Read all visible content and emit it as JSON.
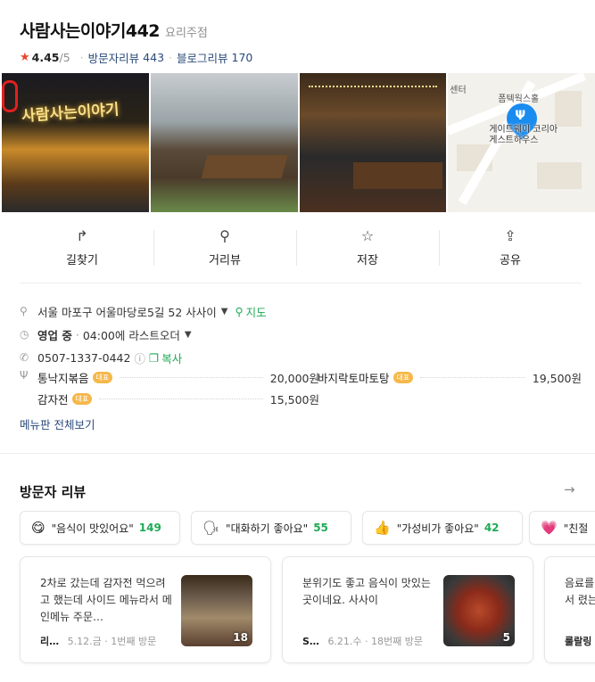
{
  "place": {
    "name": "사람사는이야기442",
    "category": "요리주점",
    "rating": "4.45",
    "rating_max": "/5",
    "visitor_review_label": "방문자리뷰",
    "visitor_review_count": "443",
    "blog_review_label": "블로그리뷰",
    "blog_review_count": "170"
  },
  "photos": {
    "sign_text": "사람사는이야기",
    "map_labels": {
      "center": "센터",
      "hall": "폼텍웍스홀",
      "pin_label_1": "게이트웨이 코리아",
      "pin_label_2": "게스트하우스"
    }
  },
  "actions": [
    {
      "label": "길찾기",
      "icon": "directions-icon"
    },
    {
      "label": "거리뷰",
      "icon": "street-view-icon"
    },
    {
      "label": "저장",
      "icon": "star-icon"
    },
    {
      "label": "공유",
      "icon": "share-icon"
    }
  ],
  "info": {
    "address": "서울 마포구 어울마당로5길 52 사사이",
    "map_link": "지도",
    "status": "영업 중",
    "last_order": "04:00에 라스트오더",
    "phone": "0507-1337-0442",
    "copy": "복사"
  },
  "menu": {
    "items": [
      {
        "name": "통낙지볶음",
        "badge": "대표",
        "price": "20,000원"
      },
      {
        "name": "바지락토마토탕",
        "badge": "대표",
        "price": "19,500원"
      },
      {
        "name": "감자전",
        "badge": "대표",
        "price": "15,500원"
      }
    ],
    "view_all": "메뉴판 전체보기"
  },
  "reviews": {
    "title": "방문자 리뷰",
    "chips": [
      {
        "emoji": "😋",
        "label": "\"음식이 맛있어요\"",
        "count": "149"
      },
      {
        "emoji": "🗣",
        "label": "\"대화하기 좋아요\"",
        "count": "55"
      },
      {
        "emoji": "👍",
        "label": "\"가성비가 좋아요\"",
        "count": "42"
      },
      {
        "emoji": "💗",
        "label": "\"친절",
        "count": ""
      }
    ],
    "cards": [
      {
        "text": "2차로 갔는데 감자전 먹으려고 했는데 사이드 메뉴라서 메인메뉴 주문…",
        "author": "리…",
        "date": "5.12.금",
        "visit": "1번째 방문",
        "photo_count": "18"
      },
      {
        "text": "분위기도 좋고 음식이 맛있는 곳이네요. 사사이",
        "author": "S…",
        "date": "6.21.수",
        "visit": "18번째 방문",
        "photo_count": "5"
      },
      {
        "text": "음료를 하셔서 렸는데",
        "author": "룰랄링",
        "date": "",
        "visit": "",
        "photo_count": ""
      }
    ]
  }
}
